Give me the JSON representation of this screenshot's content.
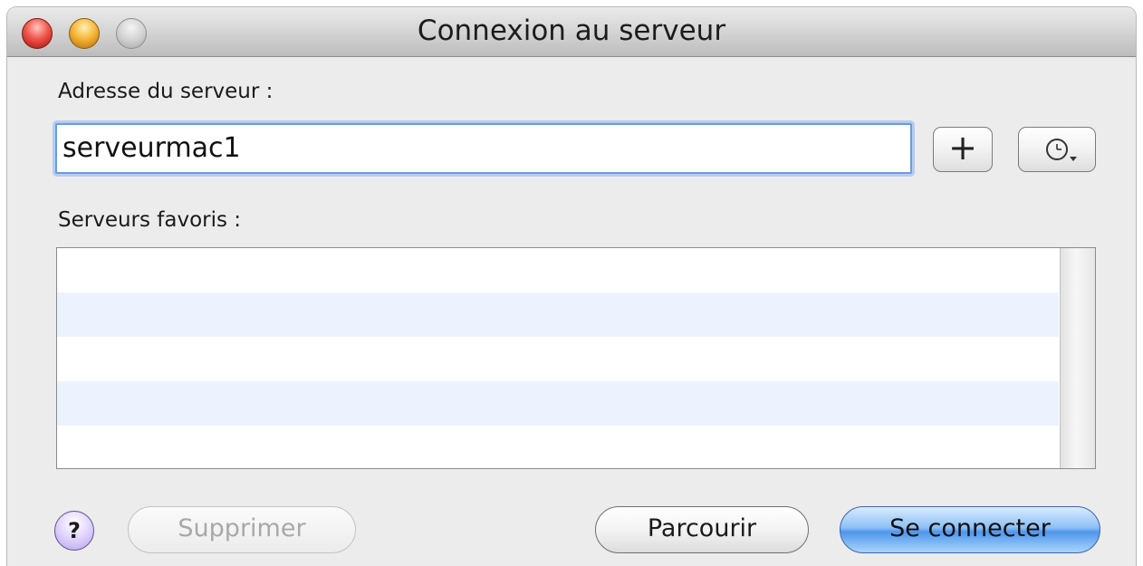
{
  "window": {
    "title": "Connexion au serveur"
  },
  "form": {
    "address_label": "Adresse du serveur :",
    "address_value": "serveurmac1",
    "add_favorite_label": "+",
    "favorites_label": "Serveurs favoris :",
    "favorites": []
  },
  "buttons": {
    "help_label": "?",
    "delete_label": "Supprimer",
    "delete_enabled": false,
    "browse_label": "Parcourir",
    "connect_label": "Se connecter"
  },
  "icons": {
    "close": "close-icon",
    "minimize": "minimize-icon",
    "zoom": "zoom-icon",
    "recent_servers": "clock-icon",
    "dropdown": "chevron-down-icon"
  },
  "colors": {
    "close": "#f0564c",
    "minimize": "#f6b73a",
    "zoom": "#cfcfcf",
    "focus_ring": "#6b9be0",
    "list_alt_row": "#edf3fe",
    "default_button": "#4f96ea",
    "disabled_text": "#a8a8a8"
  }
}
